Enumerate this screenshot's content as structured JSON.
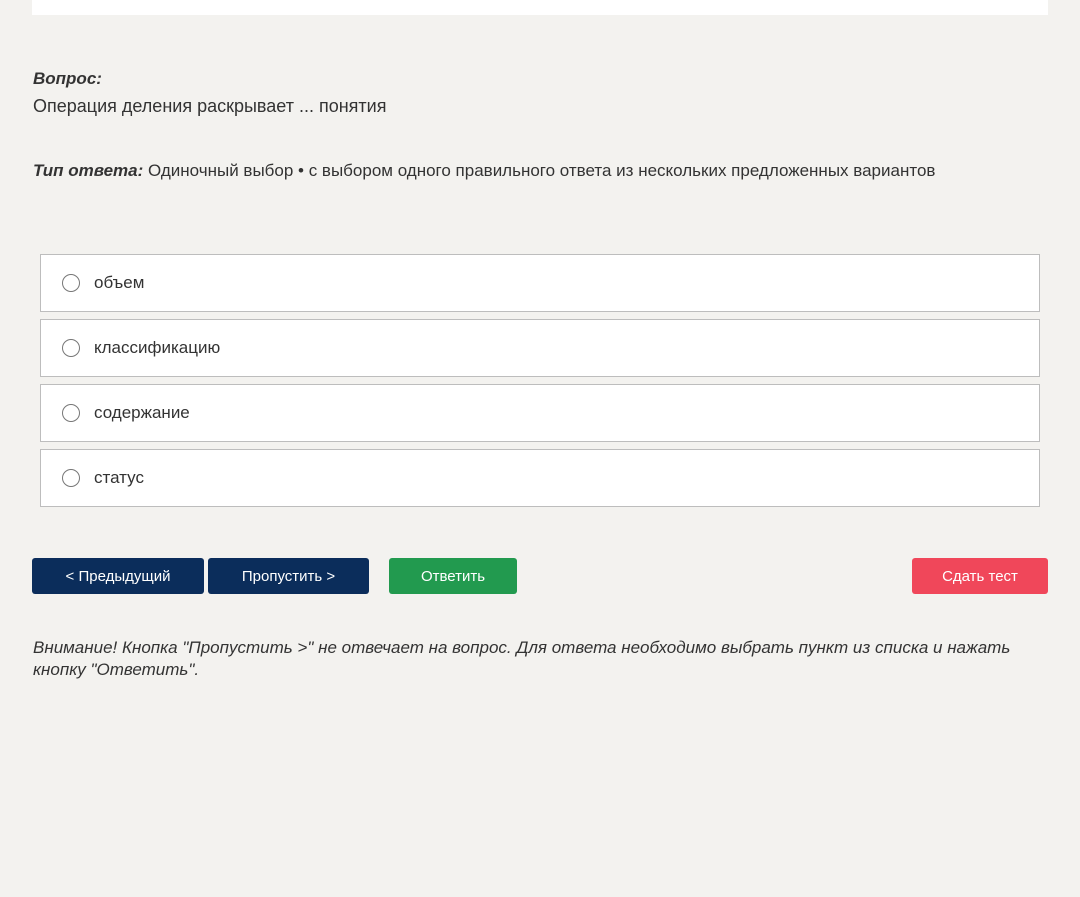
{
  "question": {
    "label": "Вопрос:",
    "text": "Операция деления раскрывает ... понятия"
  },
  "answer_type": {
    "label": "Тип ответа:",
    "value": "Одиночный выбор • с выбором одного правильного ответа из нескольких предложенных вариантов"
  },
  "options": [
    {
      "label": "объем",
      "selected": false
    },
    {
      "label": "классификацию",
      "selected": false
    },
    {
      "label": "содержание",
      "selected": false
    },
    {
      "label": "статус",
      "selected": false
    }
  ],
  "buttons": {
    "prev": "< Предыдущий",
    "skip": "Пропустить >",
    "answer": "Ответить",
    "finish": "Сдать тест"
  },
  "colors": {
    "background": "#f3f2ef",
    "nav_button": "#0b2d5b",
    "answer_button": "#229a4f",
    "finish_button": "#f0475a"
  },
  "notice": "Внимание! Кнопка \"Пропустить >\" не отвечает на вопрос. Для ответа необходимо выбрать пункт из списка и нажать кнопку \"Ответить\"."
}
